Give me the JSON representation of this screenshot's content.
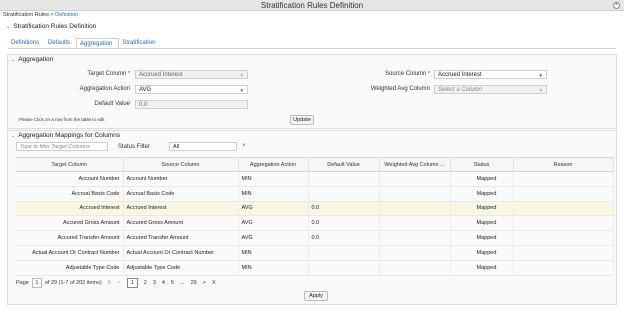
{
  "window": {
    "title": "Stratification Rules Definition",
    "close_label": "×"
  },
  "breadcrumb": {
    "root": "Stratification Rules",
    "separator": " > ",
    "current": "Definition"
  },
  "page_title": "Stratification Rules Definition",
  "tabs": [
    {
      "label": "Definitions"
    },
    {
      "label": "Defaults"
    },
    {
      "label": "Aggregation",
      "active": true
    },
    {
      "label": "Stratification"
    }
  ],
  "aggregation": {
    "section_title": "Aggregation",
    "target_column_label": "Target Column",
    "target_column_value": "Accrued Interest",
    "source_column_label": "Source Column",
    "source_column_value": "Accrued Interest",
    "aggregation_action_label": "Aggregation Action",
    "aggregation_action_value": "AVG",
    "weighted_avg_label": "Weighted Avg Column",
    "weighted_avg_placeholder": "Select a Column",
    "default_value_label": "Default Value",
    "default_value": "0.0",
    "note": "Please Click on a row from the table to edit",
    "update_label": "Update",
    "required_mark": "*"
  },
  "mappings": {
    "section_title": "Aggregation Mappings for Columns",
    "filter_placeholder": "Type to filter Target Columns",
    "status_filter_label": "Status Filter",
    "status_filter_value": "All",
    "clear_label": "×",
    "columns": [
      "Target Column",
      "Source Column",
      "Aggregation Action",
      "Default Value",
      "Weighted Avg Column ...",
      "Status",
      "Reason"
    ],
    "rows": [
      {
        "target": "Account Number",
        "source": "Account Number",
        "action": "MIN",
        "default": "",
        "weighted": "",
        "status": "Mapped",
        "reason": ""
      },
      {
        "target": "Accrual Basis Code",
        "source": "Accrual Basis Code",
        "action": "MIN",
        "default": "",
        "weighted": "",
        "status": "Mapped",
        "reason": ""
      },
      {
        "target": "Accrued Interest",
        "source": "Accrued Interest",
        "action": "AVG",
        "default": "0.0",
        "weighted": "",
        "status": "Mapped",
        "reason": "",
        "selected": true
      },
      {
        "target": "Accured Gross Amount",
        "source": "Accured Gross Amount",
        "action": "AVG",
        "default": "0.0",
        "weighted": "",
        "status": "Mapped",
        "reason": ""
      },
      {
        "target": "Accured Transfer Amount",
        "source": "Accured Transfer Amount",
        "action": "AVG",
        "default": "0.0",
        "weighted": "",
        "status": "Mapped",
        "reason": ""
      },
      {
        "target": "Actual Account Or Contract Number",
        "source": "Actual Account Or Contract Number",
        "action": "MIN",
        "default": "",
        "weighted": "",
        "status": "Mapped",
        "reason": ""
      },
      {
        "target": "Adjustable Type Code",
        "source": "Adjustable Type Code",
        "action": "MIN",
        "default": "",
        "weighted": "",
        "status": "Mapped",
        "reason": ""
      }
    ]
  },
  "pager": {
    "page_label": "Page",
    "page_value": "1",
    "of_label": "of 29",
    "items_label": "(1-7 of 202 items)",
    "first": "K",
    "prev": "<",
    "pages": [
      "1",
      "2",
      "3",
      "4",
      "5"
    ],
    "ellipsis": "...",
    "last_page": "29",
    "next": ">",
    "last": "X"
  },
  "apply_label": "Apply"
}
